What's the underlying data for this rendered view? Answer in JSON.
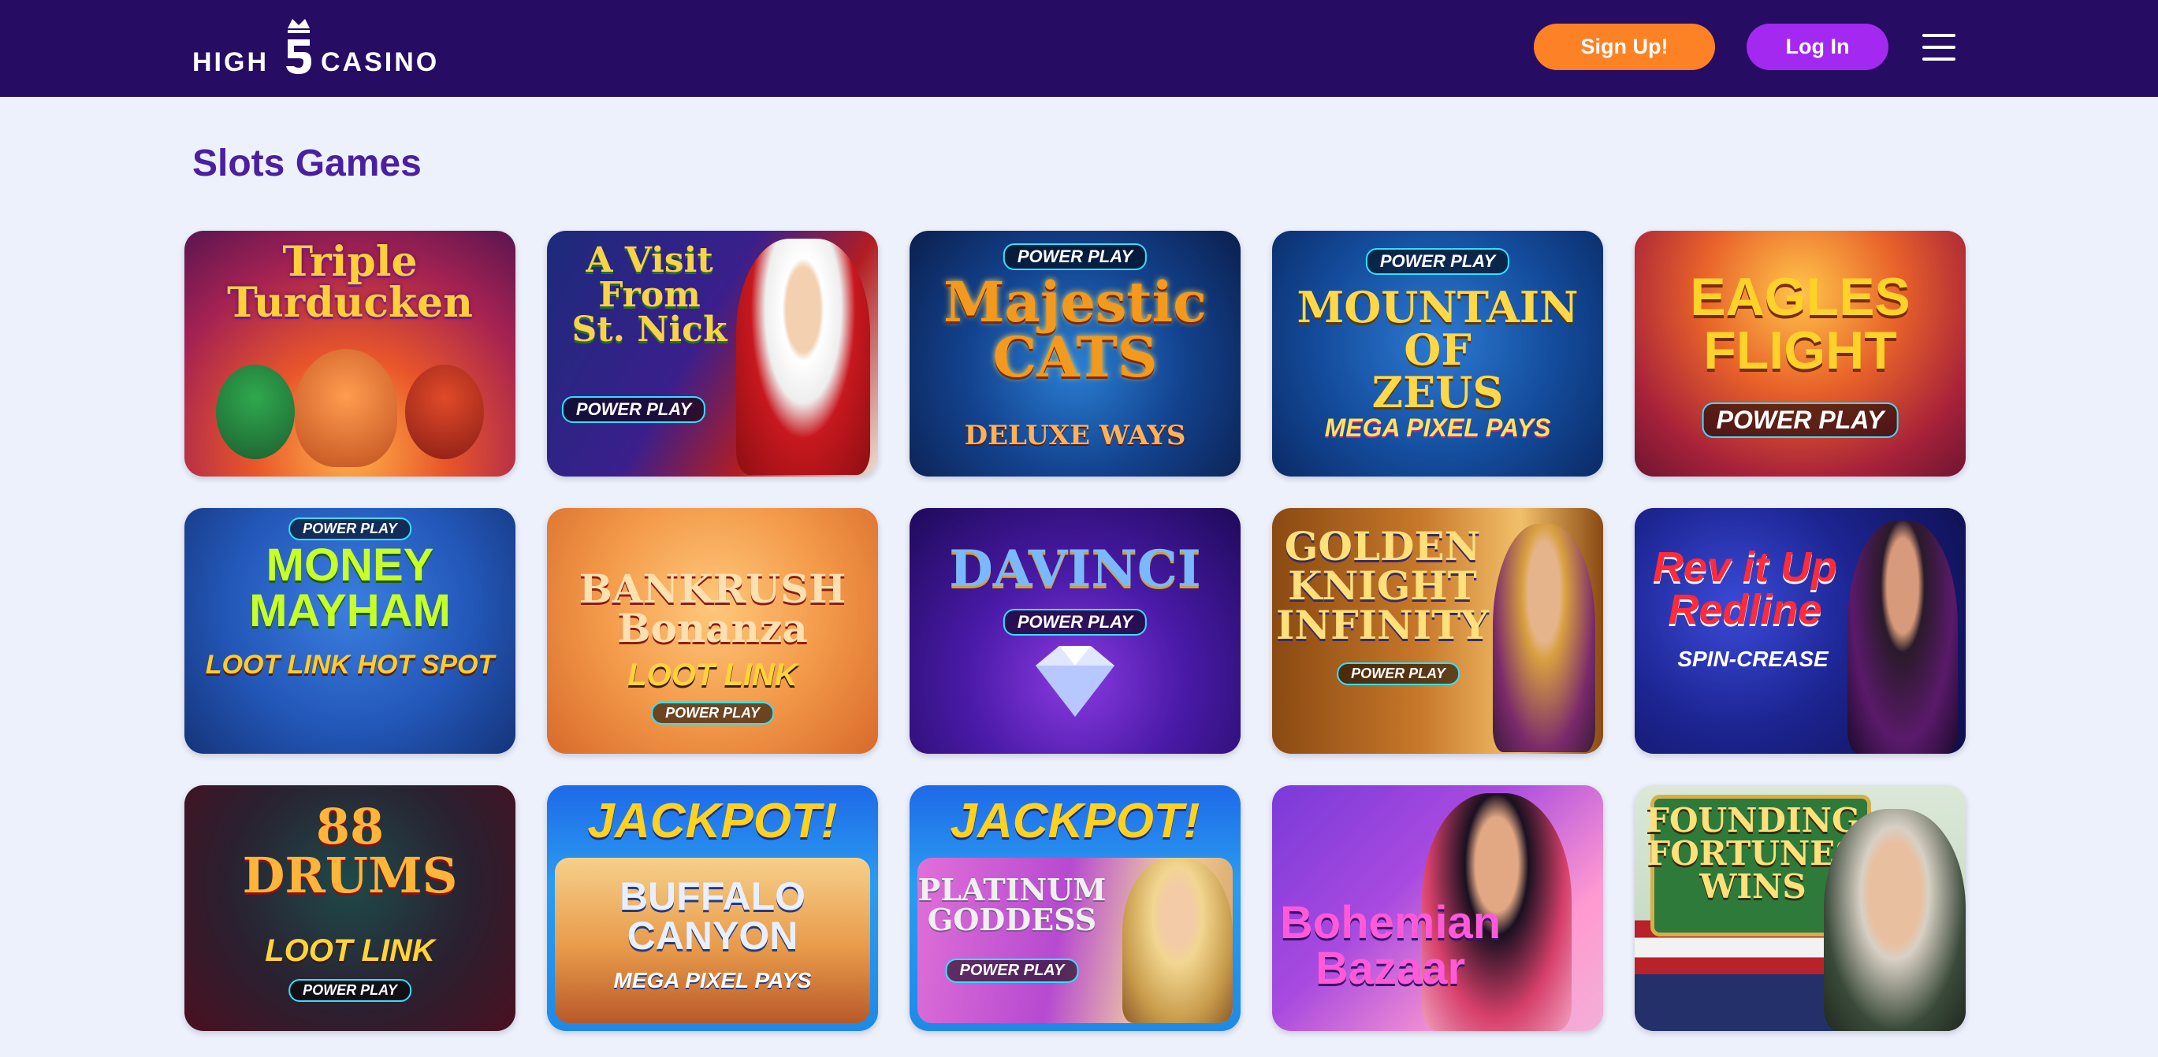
{
  "header": {
    "logo_left": "HIGH",
    "logo_right": "CASINO",
    "signup_label": "Sign Up!",
    "login_label": "Log In",
    "background": "#270c63",
    "signup_color": "#fd8125",
    "login_color": "#a329f0"
  },
  "main": {
    "section_title": "Slots Games",
    "title_color": "#4b20a0"
  },
  "games": [
    {
      "title": "Triple\nTurducken",
      "badge": "",
      "sub": ""
    },
    {
      "title": "A Visit\nFrom\nSt. Nick",
      "badge": "POWER PLAY",
      "sub": ""
    },
    {
      "title": "Majestic\nCATS",
      "badge": "POWER PLAY",
      "sub": "DELUXE WAYS"
    },
    {
      "title": "MOUNTAIN OF\nZEUS",
      "badge": "POWER PLAY",
      "sub": "MEGA PIXEL PAYS"
    },
    {
      "title": "EAGLES\nFLIGHT",
      "badge": "POWER PLAY",
      "sub": ""
    },
    {
      "title": "MONEY\nMAYHAM",
      "badge": "POWER PLAY",
      "sub": "LOOT LINK HOT SPOT"
    },
    {
      "title": "BANKRUSH\nBonanza",
      "badge": "POWER PLAY",
      "sub": "LOOT LINK"
    },
    {
      "title": "DAVINCI",
      "badge": "POWER PLAY",
      "sub": ""
    },
    {
      "title": "GOLDEN\nKNIGHT\nINFINITY",
      "badge": "POWER PLAY",
      "sub": ""
    },
    {
      "title": "Rev it Up\nRedline",
      "badge": "",
      "sub": "SPIN-CREASE"
    },
    {
      "title": "88\nDRUMS",
      "badge": "POWER PLAY",
      "sub": "LOOT LINK"
    },
    {
      "title": "BUFFALO\nCANYON",
      "badge": "",
      "sub": "MEGA PIXEL PAYS",
      "jackpot": "JACKPOT!"
    },
    {
      "title": "PLATINUM\nGODDESS",
      "badge": "POWER PLAY",
      "sub": "",
      "jackpot": "JACKPOT!"
    },
    {
      "title": "Bohemian\nBazaar",
      "badge": "",
      "sub": ""
    },
    {
      "title": "FOUNDING\nFORTUNES\nWINS",
      "badge": "",
      "sub": ""
    }
  ]
}
